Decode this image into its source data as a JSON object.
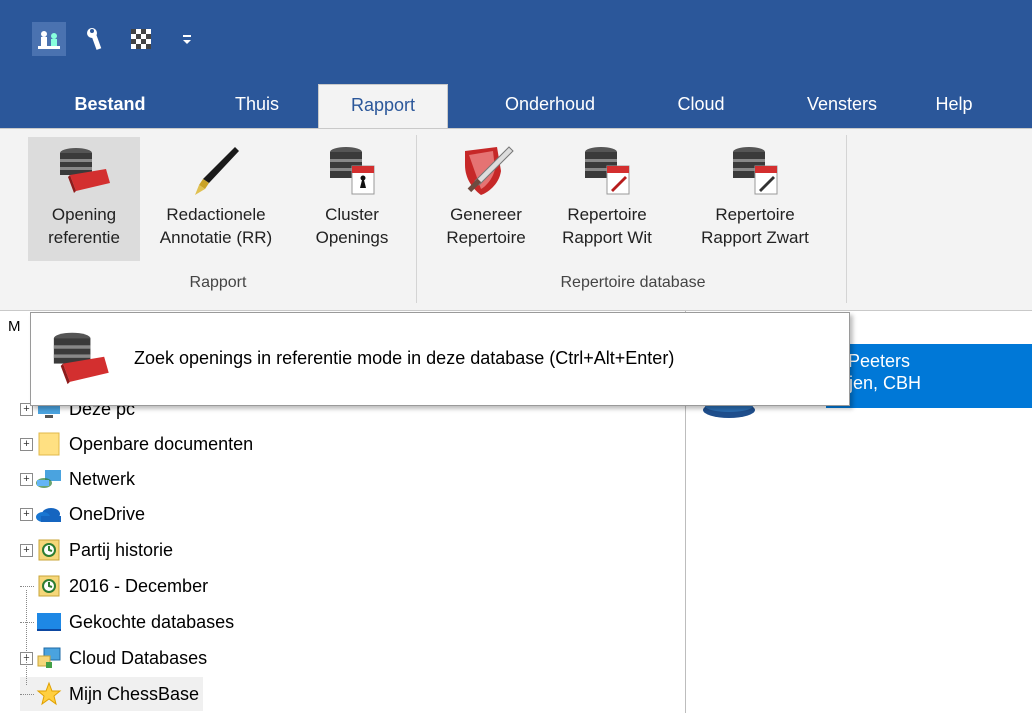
{
  "tabs": [
    {
      "label": "Bestand"
    },
    {
      "label": "Thuis"
    },
    {
      "label": "Rapport"
    },
    {
      "label": "Onderhoud"
    },
    {
      "label": "Cloud"
    },
    {
      "label": "Vensters"
    },
    {
      "label": "Help"
    }
  ],
  "ribbon": {
    "buttons": [
      {
        "line1": "Opening",
        "line2": "referentie",
        "icon": "database-book-icon"
      },
      {
        "line1": "Redactionele",
        "line2": "Annotatie (RR)",
        "icon": "fountain-pen-icon"
      },
      {
        "line1": "Cluster",
        "line2": "Openings",
        "icon": "database-rpt-icon"
      },
      {
        "line1": "Genereer",
        "line2": "Repertoire",
        "icon": "shield-sword-icon"
      },
      {
        "line1": "Repertoire",
        "line2": "Rapport Wit",
        "icon": "database-rpt-white-icon"
      },
      {
        "line1": "Repertoire",
        "line2": "Rapport Zwart",
        "icon": "database-rpt-black-icon"
      }
    ],
    "groups": [
      {
        "label": "Rapport"
      },
      {
        "label": "Repertoire database"
      }
    ]
  },
  "tooltip": {
    "text": "Zoek openings in referentie mode in deze database (Ctrl+Alt+Enter)"
  },
  "tree": {
    "leftcut": "M",
    "items": [
      {
        "label": "Deze pc",
        "icon": "computer-icon"
      },
      {
        "label": "Openbare documenten",
        "icon": "folder-icon"
      },
      {
        "label": "Netwerk",
        "icon": "network-icon"
      },
      {
        "label": "OneDrive",
        "icon": "cloud-icon"
      },
      {
        "label": "Partij historie",
        "icon": "history-icon"
      },
      {
        "label": "2016 - December",
        "icon": "history-icon"
      },
      {
        "label": "Gekochte databases",
        "icon": "monitor-icon"
      },
      {
        "label": "Cloud Databases",
        "icon": "cloud-database-icon"
      },
      {
        "label": "Mijn ChessBase",
        "icon": "star-icon"
      }
    ]
  },
  "right": {
    "line1": "s Peeters",
    "line2": "rtijen, CBH"
  },
  "colors": {
    "titlebar": "#2b579a",
    "ribbon": "#f3f3f3",
    "selection": "#0078d7"
  }
}
